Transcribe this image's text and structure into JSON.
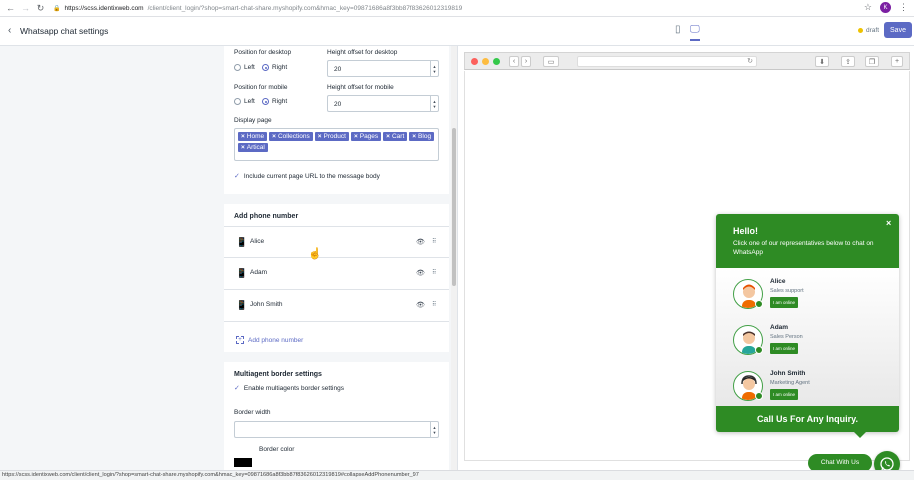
{
  "browser": {
    "url_host": "https://scss.identixweb.com",
    "url_rest": "/client/client_login/?shop=smart-chat-share.myshopify.com&hmac_key=09871686a8f3bb87f83626012319819",
    "profile_initial": "K"
  },
  "header": {
    "back_icon": "‹",
    "title": "Whatsapp chat settings",
    "status": "draft",
    "save_label": "Save"
  },
  "settings": {
    "position_desktop_label": "Position for desktop",
    "height_desktop_label": "Height offset for desktop",
    "height_desktop_value": "20",
    "position_mobile_label": "Position for mobile",
    "height_mobile_label": "Height offset for mobile",
    "height_mobile_value": "20",
    "left_label": "Left",
    "right_label": "Right",
    "display_page_label": "Display page",
    "display_pages": [
      "Home",
      "Collections",
      "Product",
      "Pages",
      "Cart",
      "Blog",
      "Artical"
    ],
    "include_url_label": "Include current page URL to the message body"
  },
  "phones": {
    "heading": "Add phone number",
    "agents": [
      "Alice",
      "Adam",
      "John Smith"
    ],
    "add_label": "Add phone number"
  },
  "border": {
    "heading": "Multiagent border settings",
    "enable_label": "Enable multiagents border settings",
    "width_label": "Border width",
    "color_label": "Border color",
    "color_value": "#000000"
  },
  "status_bar": "https://scss.identixweb.com/client/client_login/?shop=smart-chat-share.myshopify.com&hmac_key=09871686a8f3bb87f83626012319819#collapseAddPhonenumber_97",
  "widget": {
    "hello": "Hello!",
    "subtitle": "Click one of our representatives below to chat on WhatsApp",
    "close": "×",
    "agents": [
      {
        "name": "Alice",
        "role": "Sales support",
        "badge": "I am online"
      },
      {
        "name": "Adam",
        "role": "Sales Person",
        "badge": "I am online"
      },
      {
        "name": "John Smith",
        "role": "Marketing Agent",
        "badge": "I am online"
      }
    ],
    "footer": "Call Us For Any Inquiry.",
    "chat_button": "Chat With Us",
    "accent_color": "#2e8b24"
  }
}
